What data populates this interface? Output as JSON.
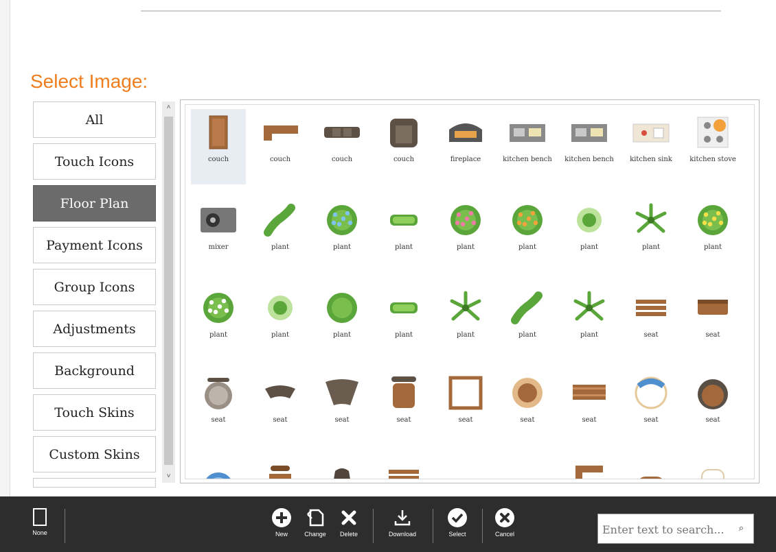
{
  "heading": "Select Image:",
  "categories": [
    {
      "label": "All",
      "active": false
    },
    {
      "label": "Touch Icons",
      "active": false
    },
    {
      "label": "Floor Plan",
      "active": true
    },
    {
      "label": "Payment Icons",
      "active": false
    },
    {
      "label": "Group Icons",
      "active": false
    },
    {
      "label": "Adjustments",
      "active": false
    },
    {
      "label": "Background",
      "active": false
    },
    {
      "label": "Touch Skins",
      "active": false
    },
    {
      "label": "Custom Skins",
      "active": false
    }
  ],
  "images": [
    {
      "label": "couch",
      "icon": "couch-icon",
      "selected": true
    },
    {
      "label": "couch",
      "icon": "couch-corner-icon"
    },
    {
      "label": "couch",
      "icon": "couch-long-icon"
    },
    {
      "label": "couch",
      "icon": "armchair-icon"
    },
    {
      "label": "fireplace",
      "icon": "fireplace-icon"
    },
    {
      "label": "kitchen bench",
      "icon": "kitchen-bench-icon"
    },
    {
      "label": "kitchen bench",
      "icon": "kitchen-bench-icon"
    },
    {
      "label": "kitchen sink",
      "icon": "kitchen-sink-icon"
    },
    {
      "label": "kitchen stove",
      "icon": "kitchen-stove-icon"
    },
    {
      "label": "mixer",
      "icon": "mixer-icon"
    },
    {
      "label": "plant",
      "icon": "plant-hedge-curve-icon"
    },
    {
      "label": "plant",
      "icon": "plant-blue-flower-icon"
    },
    {
      "label": "plant",
      "icon": "plant-hedge-icon"
    },
    {
      "label": "plant",
      "icon": "plant-pink-flower-icon"
    },
    {
      "label": "plant",
      "icon": "plant-orange-flower-icon"
    },
    {
      "label": "plant",
      "icon": "plant-sparse-icon"
    },
    {
      "label": "plant",
      "icon": "plant-star-icon"
    },
    {
      "label": "plant",
      "icon": "plant-yellow-flower-icon"
    },
    {
      "label": "plant",
      "icon": "plant-white-flower-icon"
    },
    {
      "label": "plant",
      "icon": "plant-grass-icon"
    },
    {
      "label": "plant",
      "icon": "plant-shrub-icon"
    },
    {
      "label": "plant",
      "icon": "plant-hedge-icon"
    },
    {
      "label": "plant",
      "icon": "plant-fern-icon"
    },
    {
      "label": "plant",
      "icon": "plant-hedge-curve-icon"
    },
    {
      "label": "plant",
      "icon": "plant-palm-icon"
    },
    {
      "label": "seat",
      "icon": "bench-slats-icon"
    },
    {
      "label": "seat",
      "icon": "bench-icon"
    },
    {
      "label": "seat",
      "icon": "round-stool-icon"
    },
    {
      "label": "seat",
      "icon": "curved-seat-icon"
    },
    {
      "label": "seat",
      "icon": "curved-seat-large-icon"
    },
    {
      "label": "seat",
      "icon": "chair-icon"
    },
    {
      "label": "seat",
      "icon": "square-table-icon"
    },
    {
      "label": "seat",
      "icon": "round-table-icon"
    },
    {
      "label": "seat",
      "icon": "bench-long-icon"
    },
    {
      "label": "seat",
      "icon": "blue-round-seat-icon"
    },
    {
      "label": "seat",
      "icon": "round-chair-icon"
    },
    {
      "label": "",
      "icon": "blue-stool-icon"
    },
    {
      "label": "",
      "icon": "wood-chair-icon"
    },
    {
      "label": "",
      "icon": "dark-chair-icon"
    },
    {
      "label": "",
      "icon": "bench-slats-icon"
    },
    {
      "label": "",
      "icon": "plank-bench-icon"
    },
    {
      "label": "",
      "icon": "blue-ring-seat-icon"
    },
    {
      "label": "",
      "icon": "corner-bench-icon"
    },
    {
      "label": "",
      "icon": "wood-stool-icon"
    },
    {
      "label": "",
      "icon": "white-chair-icon"
    }
  ],
  "toolbar": {
    "none": "None",
    "new": "New",
    "change": "Change",
    "delete": "Delete",
    "download": "Download",
    "select": "Select",
    "cancel": "Cancel"
  },
  "search": {
    "placeholder": "Enter text to search..."
  },
  "colors": {
    "accent": "#f07d1d",
    "toolbar": "#2d2d2d",
    "active_category": "#6b6b6b"
  }
}
